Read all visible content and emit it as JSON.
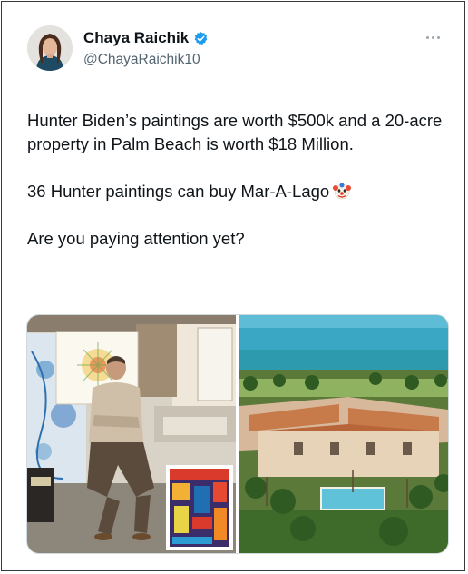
{
  "author": {
    "display_name": "Chaya Raichik",
    "handle": "@ChayaRaichik10",
    "verified": true,
    "avatar_icon": "profile-photo"
  },
  "tweet": {
    "paragraphs": [
      "Hunter Biden’s paintings are worth $500k and a 20-acre property in Palm Beach is worth $18 Million.",
      "36 Hunter paintings can buy Mar-A-Lago",
      "Are you paying attention yet?"
    ],
    "emoji": "clown-face-icon"
  },
  "media": {
    "images": [
      {
        "subject": "man-in-art-studio-photo"
      },
      {
        "subject": "aerial-estate-photo"
      }
    ]
  },
  "colors": {
    "verified_badge": "#1d9bf0",
    "text_primary": "#0f1419",
    "text_secondary": "#536471"
  }
}
